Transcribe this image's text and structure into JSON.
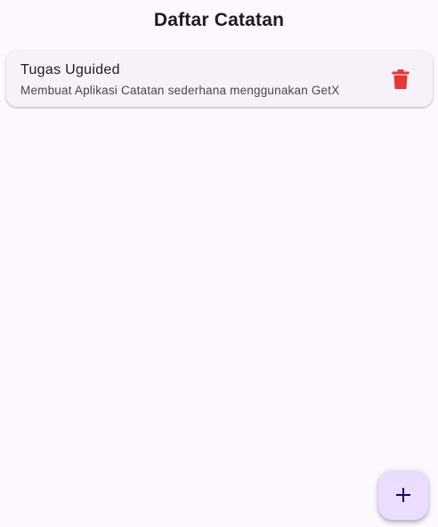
{
  "appbar": {
    "title": "Daftar Catatan"
  },
  "notes": [
    {
      "title": "Tugas Uguided",
      "subtitle": "Membuat Aplikasi Catatan sederhana menggunakan GetX",
      "delete_icon": "trash-icon"
    }
  ],
  "fab": {
    "icon": "plus-icon"
  },
  "colors": {
    "background": "#fdf7fe",
    "card": "#f7f2fa",
    "delete": "#e53935",
    "fab": "#eaddff",
    "fab_icon": "#21005d"
  }
}
